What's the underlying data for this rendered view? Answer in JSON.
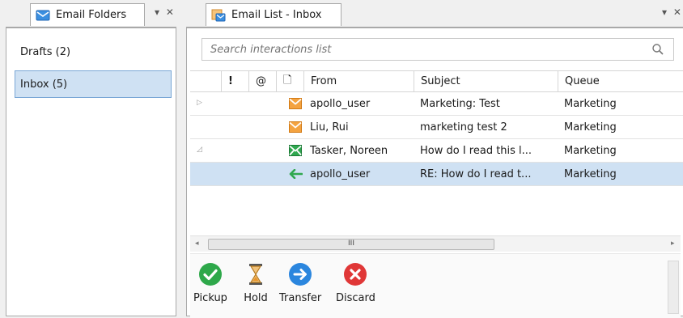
{
  "folders_panel": {
    "tab_title": "Email Folders",
    "pin_close": "▾ ✕",
    "items": [
      {
        "label": "Drafts (2)",
        "selected": false
      },
      {
        "label": "Inbox (5)",
        "selected": true
      }
    ]
  },
  "list_panel": {
    "tab_title": "Email List - Inbox",
    "pin_close": "▾ ✕",
    "search_placeholder": "Search interactions list",
    "columns": {
      "priority": "!",
      "attachment": "@",
      "state": "🗋",
      "from": "From",
      "subject": "Subject",
      "queue": "Queue"
    },
    "rows": [
      {
        "expander": "▷",
        "icon": "envelope-orange-icon",
        "from": "apollo_user",
        "subject": "Marketing: Test",
        "queue": "Marketing",
        "selected": false
      },
      {
        "expander": "",
        "icon": "envelope-orange-icon",
        "from": "Liu, Rui",
        "subject": "marketing test 2",
        "queue": "Marketing",
        "selected": false
      },
      {
        "expander": "◿",
        "icon": "envelope-green-icon",
        "from": "Tasker, Noreen",
        "subject": "How do I read this l...",
        "queue": "Marketing",
        "selected": false
      },
      {
        "expander": "",
        "icon": "reply-arrow-green-icon",
        "from": "apollo_user",
        "subject": "RE: How do I read t...",
        "queue": "Marketing",
        "selected": true
      }
    ],
    "scroll_thumb": "III",
    "actions": [
      {
        "label": "Pickup",
        "icon": "checkmark-circle-icon",
        "color": "#2ea84a"
      },
      {
        "label": "Hold",
        "icon": "hourglass-icon",
        "color": "#e8a33a"
      },
      {
        "label": "Transfer",
        "icon": "transfer-arrow-icon",
        "color": "#2b86de"
      },
      {
        "label": "Discard",
        "icon": "x-circle-icon",
        "color": "#e03737"
      }
    ]
  }
}
